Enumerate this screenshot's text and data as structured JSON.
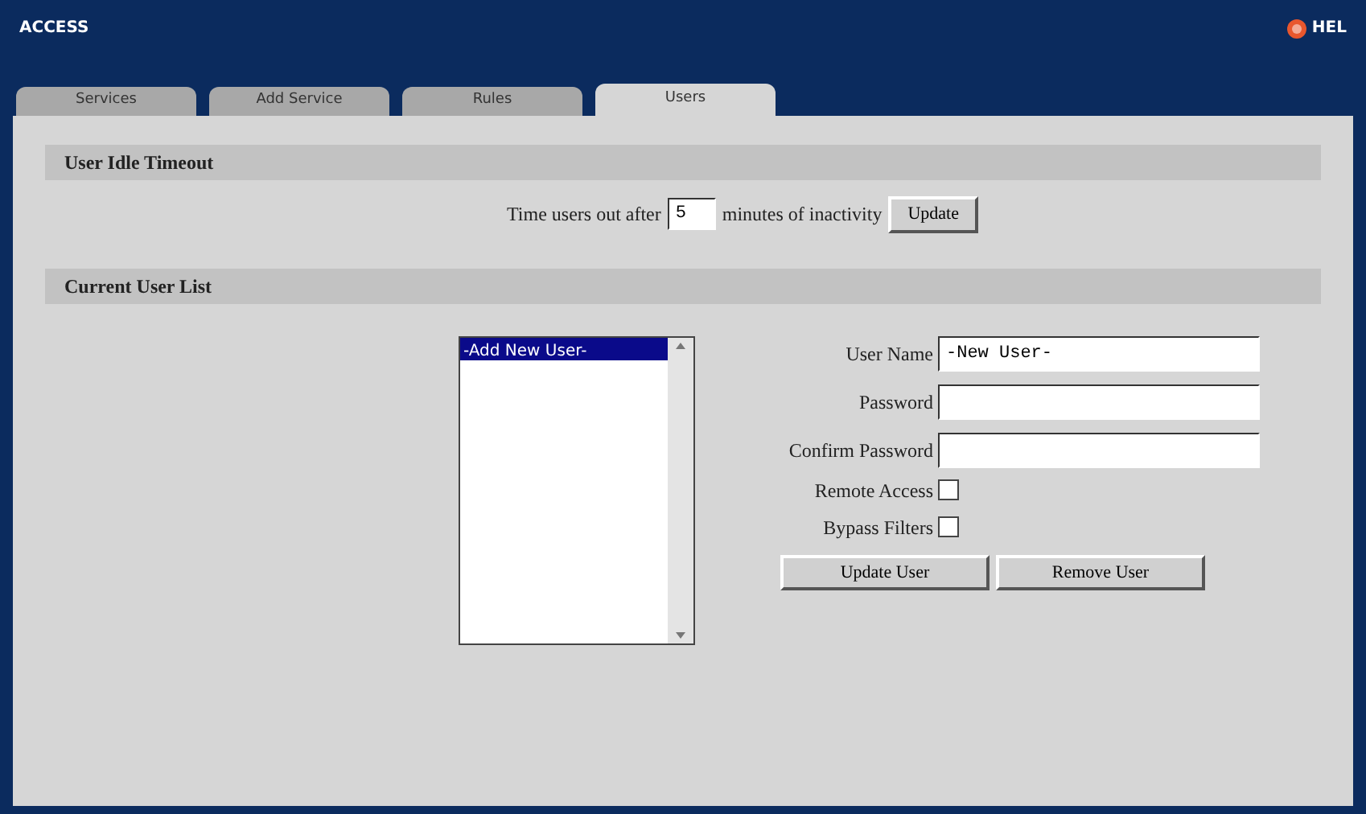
{
  "header": {
    "title": "ACCESS",
    "help": "HEL"
  },
  "tabs": [
    {
      "label": "Services",
      "selected": false
    },
    {
      "label": "Add Service",
      "selected": false
    },
    {
      "label": "Rules",
      "selected": false
    },
    {
      "label": "Users",
      "selected": true
    }
  ],
  "idle_timeout": {
    "heading": "User Idle Timeout",
    "prefix": "Time users out after",
    "value": "5",
    "suffix": "minutes of inactivity",
    "button": "Update"
  },
  "user_list": {
    "heading": "Current User List",
    "items": [
      {
        "label": "-Add New User-",
        "selected": true
      }
    ],
    "fields": [
      {
        "label": "User Name",
        "value": "-New User-"
      },
      {
        "label": "Password"
      },
      {
        "label": "Confirm Password"
      }
    ],
    "checkboxes": [
      {
        "label": "Remote Access",
        "checked": false
      },
      {
        "label": "Bypass Filters",
        "checked": false
      }
    ],
    "buttons": [
      "Update User",
      "Remove User"
    ]
  }
}
